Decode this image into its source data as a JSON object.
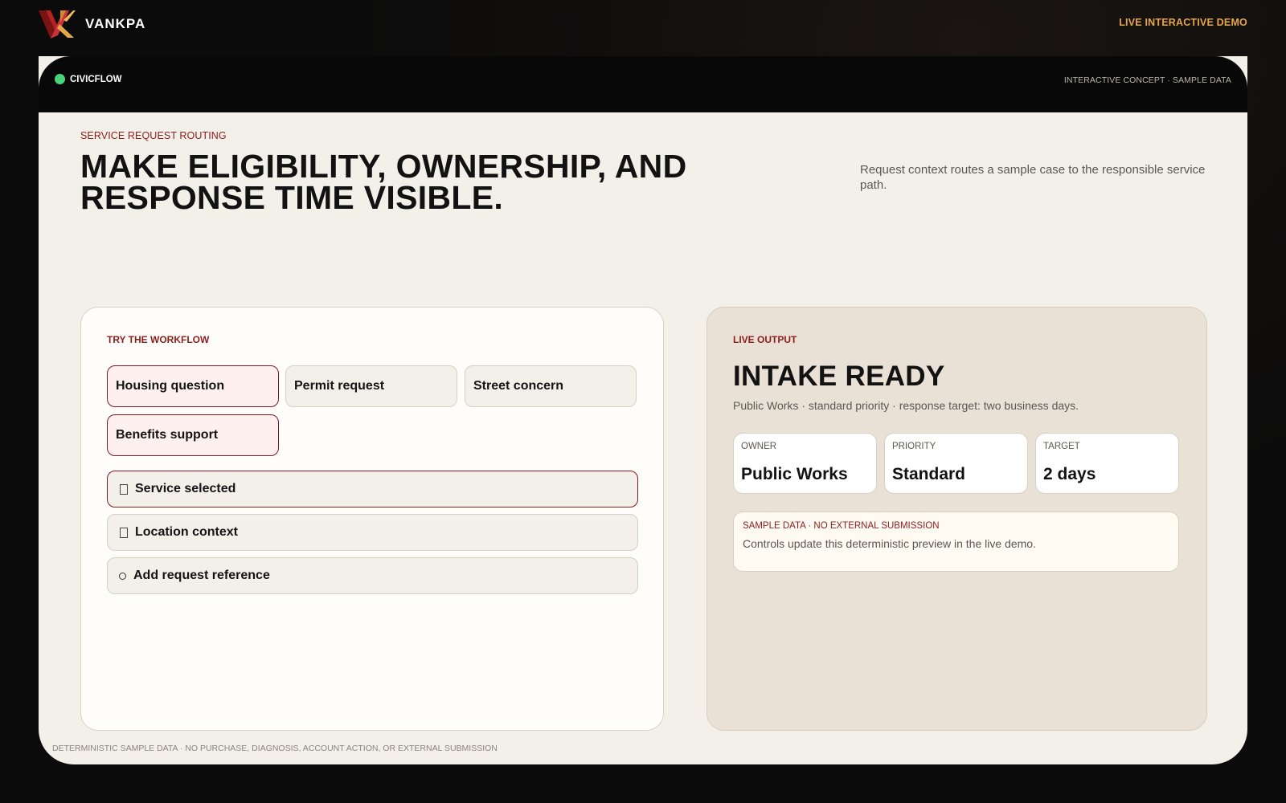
{
  "header": {
    "brand_name": "VANKPA",
    "live_demo_label": "LIVE INTERACTIVE DEMO"
  },
  "window": {
    "app_name": "CIVICFLOW",
    "concept_label": "INTERACTIVE CONCEPT · SAMPLE DATA",
    "eyebrow": "SERVICE REQUEST ROUTING",
    "headline": "MAKE ELIGIBILITY, OWNERSHIP, AND RESPONSE TIME VISIBLE.",
    "lede": "Request context routes a sample case to the responsible service path."
  },
  "workflow": {
    "eyebrow": "TRY THE WORKFLOW",
    "options": [
      {
        "label": "Housing question",
        "selected": true
      },
      {
        "label": "Permit request",
        "selected": false
      },
      {
        "label": "Street concern",
        "selected": false
      },
      {
        "label": "Benefits support",
        "selected": true
      }
    ],
    "checklist": [
      {
        "label": "Service selected",
        "state": "checked"
      },
      {
        "label": "Location context",
        "state": "checked"
      },
      {
        "label": "Add request reference",
        "glyph": "○",
        "state": "open"
      }
    ]
  },
  "output": {
    "eyebrow": "LIVE OUTPUT",
    "status": "INTAKE READY",
    "summary": "Public Works · standard priority · response target: two business days.",
    "metrics": [
      {
        "label": "OWNER",
        "value": "Public Works"
      },
      {
        "label": "PRIORITY",
        "value": "Standard"
      },
      {
        "label": "TARGET",
        "value": "2 days"
      }
    ],
    "notice_label": "SAMPLE DATA · NO EXTERNAL SUBMISSION",
    "notice_text": "Controls update this deterministic preview in the live demo."
  },
  "footer": {
    "disclaimer": "DETERMINISTIC SAMPLE DATA · NO PURCHASE, DIAGNOSIS, ACCOUNT ACTION, OR EXTERNAL SUBMISSION"
  },
  "colors": {
    "accent": "#8c1d1d",
    "brand_gold": "#e8a64a",
    "status_green": "#4bd17a",
    "selected_border": "#7d1a24",
    "page_background": "#0b0b0b",
    "canvas_background": "#f3efe9",
    "output_panel_background": "#e9e1d6"
  },
  "icons": {
    "brand_logo": "vk-logo",
    "status_indicator": "status-dot-icon",
    "checked_item": "checkbox-icon",
    "open_item": "circle-icon"
  }
}
